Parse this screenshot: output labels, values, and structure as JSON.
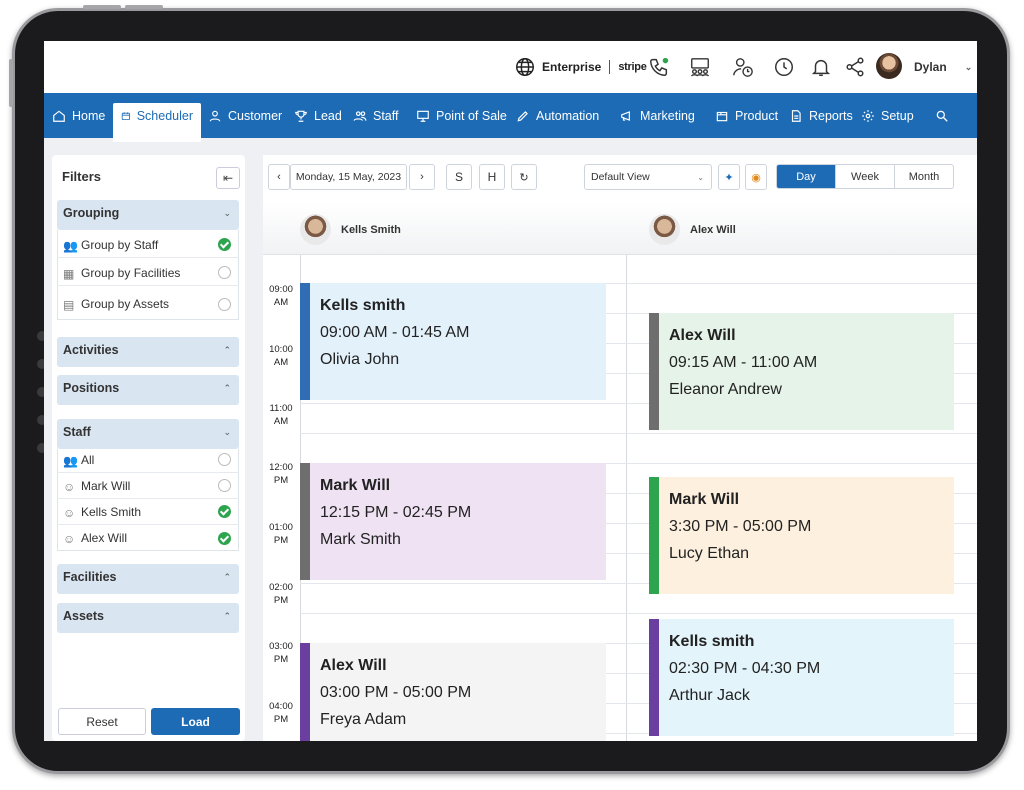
{
  "topbar": {
    "company": "Enterprise",
    "payment": "stripe",
    "user_name": "Dylan",
    "icons": [
      "globe-icon",
      "phone-icon",
      "meeting-icon",
      "user-clock-icon",
      "clock-icon",
      "bell-icon",
      "share-icon"
    ]
  },
  "nav": {
    "items": [
      {
        "label": "Home",
        "icon": "home-icon"
      },
      {
        "label": "Scheduler",
        "icon": "calendar-icon",
        "active": true
      },
      {
        "label": "Customer",
        "icon": "user-icon"
      },
      {
        "label": "Lead",
        "icon": "trophy-icon"
      },
      {
        "label": "Staff",
        "icon": "users-icon"
      },
      {
        "label": "Point of Sale",
        "icon": "monitor-icon"
      },
      {
        "label": "Automation",
        "icon": "pen-icon"
      },
      {
        "label": "Marketing",
        "icon": "megaphone-icon"
      },
      {
        "label": "Product",
        "icon": "box-icon"
      },
      {
        "label": "Reports",
        "icon": "report-icon"
      },
      {
        "label": "Setup",
        "icon": "gear-icon"
      }
    ]
  },
  "filters": {
    "title": "Filters",
    "sections": {
      "grouping": {
        "label": "Grouping",
        "options": [
          {
            "label": "Group by Staff",
            "checked": true
          },
          {
            "label": "Group by Facilities",
            "checked": false
          },
          {
            "label": "Group by Assets",
            "checked": false
          }
        ]
      },
      "activities": {
        "label": "Activities"
      },
      "positions": {
        "label": "Positions"
      },
      "staff": {
        "label": "Staff",
        "options": [
          {
            "label": "All",
            "checked": false
          },
          {
            "label": "Mark Will",
            "checked": false
          },
          {
            "label": "Kells Smith",
            "checked": true
          },
          {
            "label": "Alex Will",
            "checked": true
          }
        ]
      },
      "facilities": {
        "label": "Facilities"
      },
      "assets": {
        "label": "Assets"
      }
    },
    "reset_label": "Reset",
    "load_label": "Load"
  },
  "calendar": {
    "date": "Monday, 15 May, 2023",
    "s_label": "S",
    "h_label": "H",
    "view_select": "Default View",
    "segments": [
      "Day",
      "Week",
      "Month"
    ],
    "active_segment": "Day",
    "resources": [
      {
        "name": "Kells Smith"
      },
      {
        "name": "Alex  Will"
      }
    ],
    "times": [
      {
        "h": "09:00",
        "p": "AM"
      },
      {
        "h": "10:00",
        "p": "AM"
      },
      {
        "h": "11:00",
        "p": "AM"
      },
      {
        "h": "12:00",
        "p": "PM"
      },
      {
        "h": "01:00",
        "p": "PM"
      },
      {
        "h": "02:00",
        "p": "PM"
      },
      {
        "h": "03:00",
        "p": "PM"
      },
      {
        "h": "04:00",
        "p": "PM"
      }
    ],
    "events": [
      {
        "title": "Kells smith",
        "time": "09:00 AM - 01:45 AM",
        "client": "Olivia John",
        "color": "#2f6db5",
        "bg": "#e3f1fb"
      },
      {
        "title": "Mark Will",
        "time": "12:15 PM - 02:45 PM",
        "client": "Mark Smith",
        "color": "#6e6e6e",
        "bg": "#efe2f3"
      },
      {
        "title": "Alex  Will",
        "time": "03:00 PM - 05:00 PM",
        "client": "Freya Adam",
        "color": "#6a3fa0",
        "bg": "#f4f4f4"
      },
      {
        "title": "Alex  Will",
        "time": "09:15 AM - 11:00 AM",
        "client": "Eleanor Andrew",
        "color": "#6e6e6e",
        "bg": "#e6f3e8"
      },
      {
        "title": "Mark Will",
        "time": "3:30 PM - 05:00 PM",
        "client": "Lucy Ethan",
        "color": "#2ea44f",
        "bg": "#fdf0df"
      },
      {
        "title": "Kells smith",
        "time": "02:30 PM - 04:30 PM",
        "client": "Arthur Jack",
        "color": "#6a3fa0",
        "bg": "#e3f4fb"
      }
    ]
  }
}
